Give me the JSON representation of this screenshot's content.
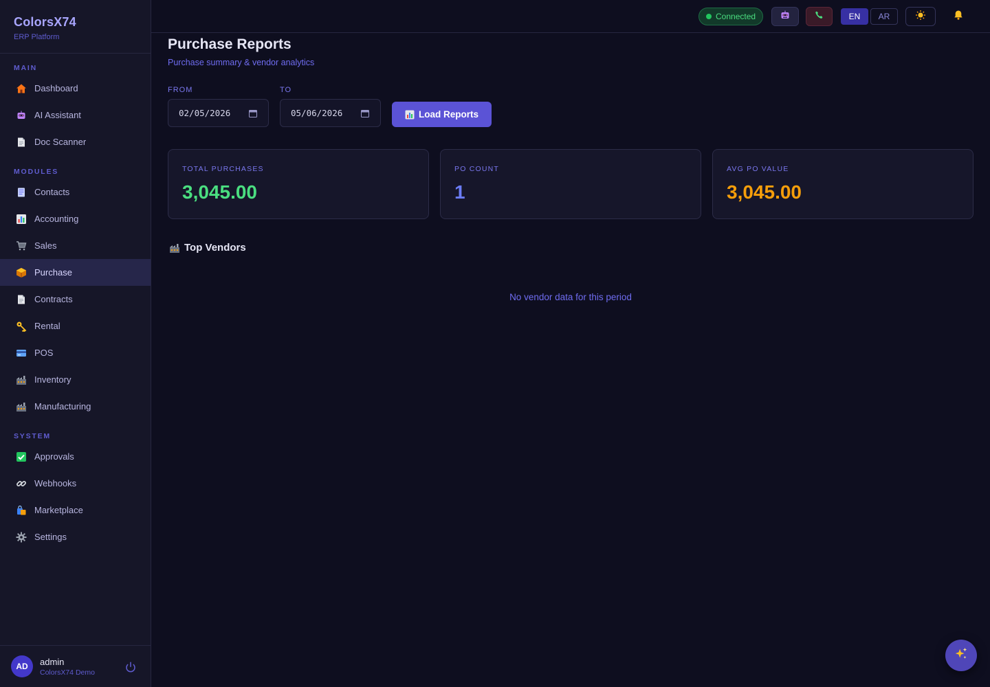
{
  "brand": {
    "name": "ColorsX74",
    "subtitle": "ERP Platform"
  },
  "sidebar": {
    "sections": [
      {
        "label": "MAIN",
        "items": [
          {
            "label": "Dashboard",
            "icon": "house-icon"
          },
          {
            "label": "AI Assistant",
            "icon": "robot-icon"
          },
          {
            "label": "Doc Scanner",
            "icon": "document-icon"
          }
        ]
      },
      {
        "label": "MODULES",
        "items": [
          {
            "label": "Contacts",
            "icon": "contacts-icon"
          },
          {
            "label": "Accounting",
            "icon": "chart-icon"
          },
          {
            "label": "Sales",
            "icon": "cart-icon"
          },
          {
            "label": "Purchase",
            "icon": "package-icon",
            "active": true
          },
          {
            "label": "Contracts",
            "icon": "document-icon"
          },
          {
            "label": "Rental",
            "icon": "key-icon"
          },
          {
            "label": "POS",
            "icon": "credit-card-icon"
          },
          {
            "label": "Inventory",
            "icon": "factory-icon"
          },
          {
            "label": "Manufacturing",
            "icon": "factory-icon"
          }
        ]
      },
      {
        "label": "SYSTEM",
        "items": [
          {
            "label": "Approvals",
            "icon": "check-icon"
          },
          {
            "label": "Webhooks",
            "icon": "link-icon"
          },
          {
            "label": "Marketplace",
            "icon": "shopping-bags-icon"
          },
          {
            "label": "Settings",
            "icon": "gear-icon"
          }
        ]
      }
    ]
  },
  "user": {
    "initials": "AD",
    "name": "admin",
    "org": "ColorsX74 Demo"
  },
  "topbar": {
    "status": "Connected",
    "lang_en": "EN",
    "lang_ar": "AR",
    "active_lang": "EN"
  },
  "page": {
    "title": "Purchase Reports",
    "subtitle": "Purchase summary & vendor analytics",
    "from_label": "FROM",
    "to_label": "TO",
    "from_value": "02/05/2026",
    "to_value": "05/06/2026",
    "load_button": "Load Reports"
  },
  "stats": [
    {
      "label": "TOTAL PURCHASES",
      "value": "3,045.00",
      "color": "#4ade80"
    },
    {
      "label": "PO COUNT",
      "value": "1",
      "color": "#6b7cf5"
    },
    {
      "label": "AVG PO VALUE",
      "value": "3,045.00",
      "color": "#f59e0b"
    }
  ],
  "vendors": {
    "title": "Top Vendors",
    "empty_message": "No vendor data for this period"
  }
}
